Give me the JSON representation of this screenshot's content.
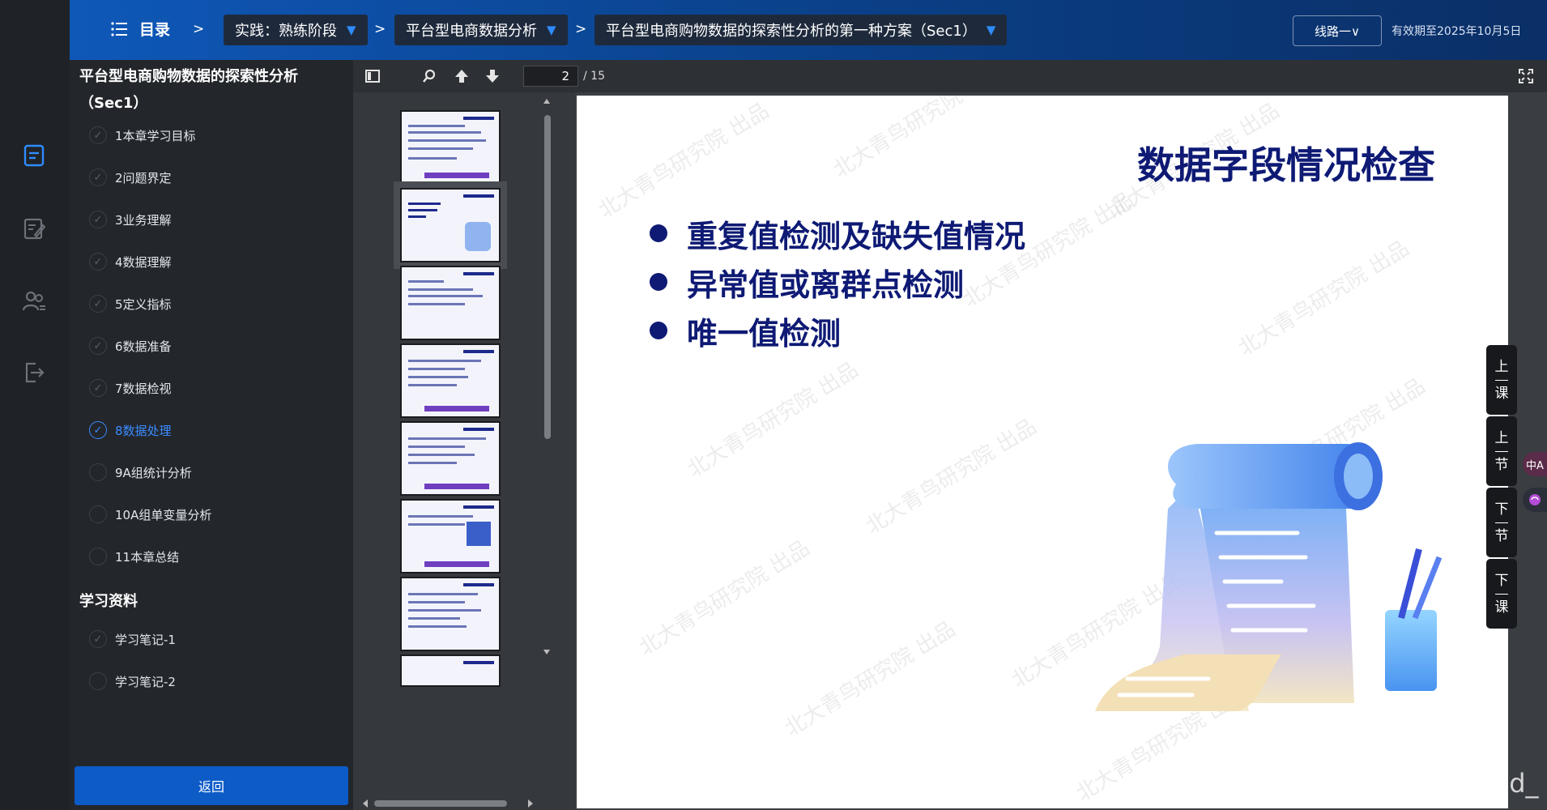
{
  "topbar": {
    "menu_label": "目录",
    "sep": ">",
    "crumbs": [
      "实践：熟练阶段",
      "平台型电商数据分析",
      "平台型电商购物数据的探索性分析的第一种方案（Sec1）"
    ],
    "caret": "▼",
    "route_label": "线路一∨",
    "valid_until": "有效期至2025年10月5日"
  },
  "sidebar": {
    "title": "平台型电商购物数据的探索性分析（Sec1）",
    "check_mark": "✓",
    "items": [
      {
        "label": "1本章学习目标",
        "active": false
      },
      {
        "label": "2问题界定",
        "active": false
      },
      {
        "label": "3业务理解",
        "active": false
      },
      {
        "label": "4数据理解",
        "active": false
      },
      {
        "label": "5定义指标",
        "active": false
      },
      {
        "label": "6数据准备",
        "active": false
      },
      {
        "label": "7数据检视",
        "active": false
      },
      {
        "label": "8数据处理",
        "active": true
      },
      {
        "label": "9A组统计分析",
        "active": false
      },
      {
        "label": "10A组单变量分析",
        "active": false
      },
      {
        "label": "11本章总结",
        "active": false
      }
    ],
    "materials_title": "学习资料",
    "materials": [
      {
        "label": "学习笔记-1"
      },
      {
        "label": "学习笔记-2"
      }
    ],
    "back_label": "返回"
  },
  "viewer": {
    "page_current": "2",
    "page_total": "/ 15",
    "slide": {
      "title": "数据字段情况检查",
      "bullets": [
        "重复值检测及缺失值情况",
        "异常值或离群点检测",
        "唯一值检测"
      ],
      "watermark_text": "北大青鸟研究院 出品"
    },
    "side_buttons": [
      {
        "top": "上",
        "bottom": "课"
      },
      {
        "top": "上",
        "bottom": "节"
      },
      {
        "top": "下",
        "bottom": "节"
      },
      {
        "top": "下",
        "bottom": "课"
      }
    ],
    "float_translate": "中A"
  },
  "credit": "CSDN @Waitind_",
  "colors": {
    "accent": "#0d5bc7",
    "active_item": "#3b8cff",
    "slide_text": "#0e1a74"
  }
}
